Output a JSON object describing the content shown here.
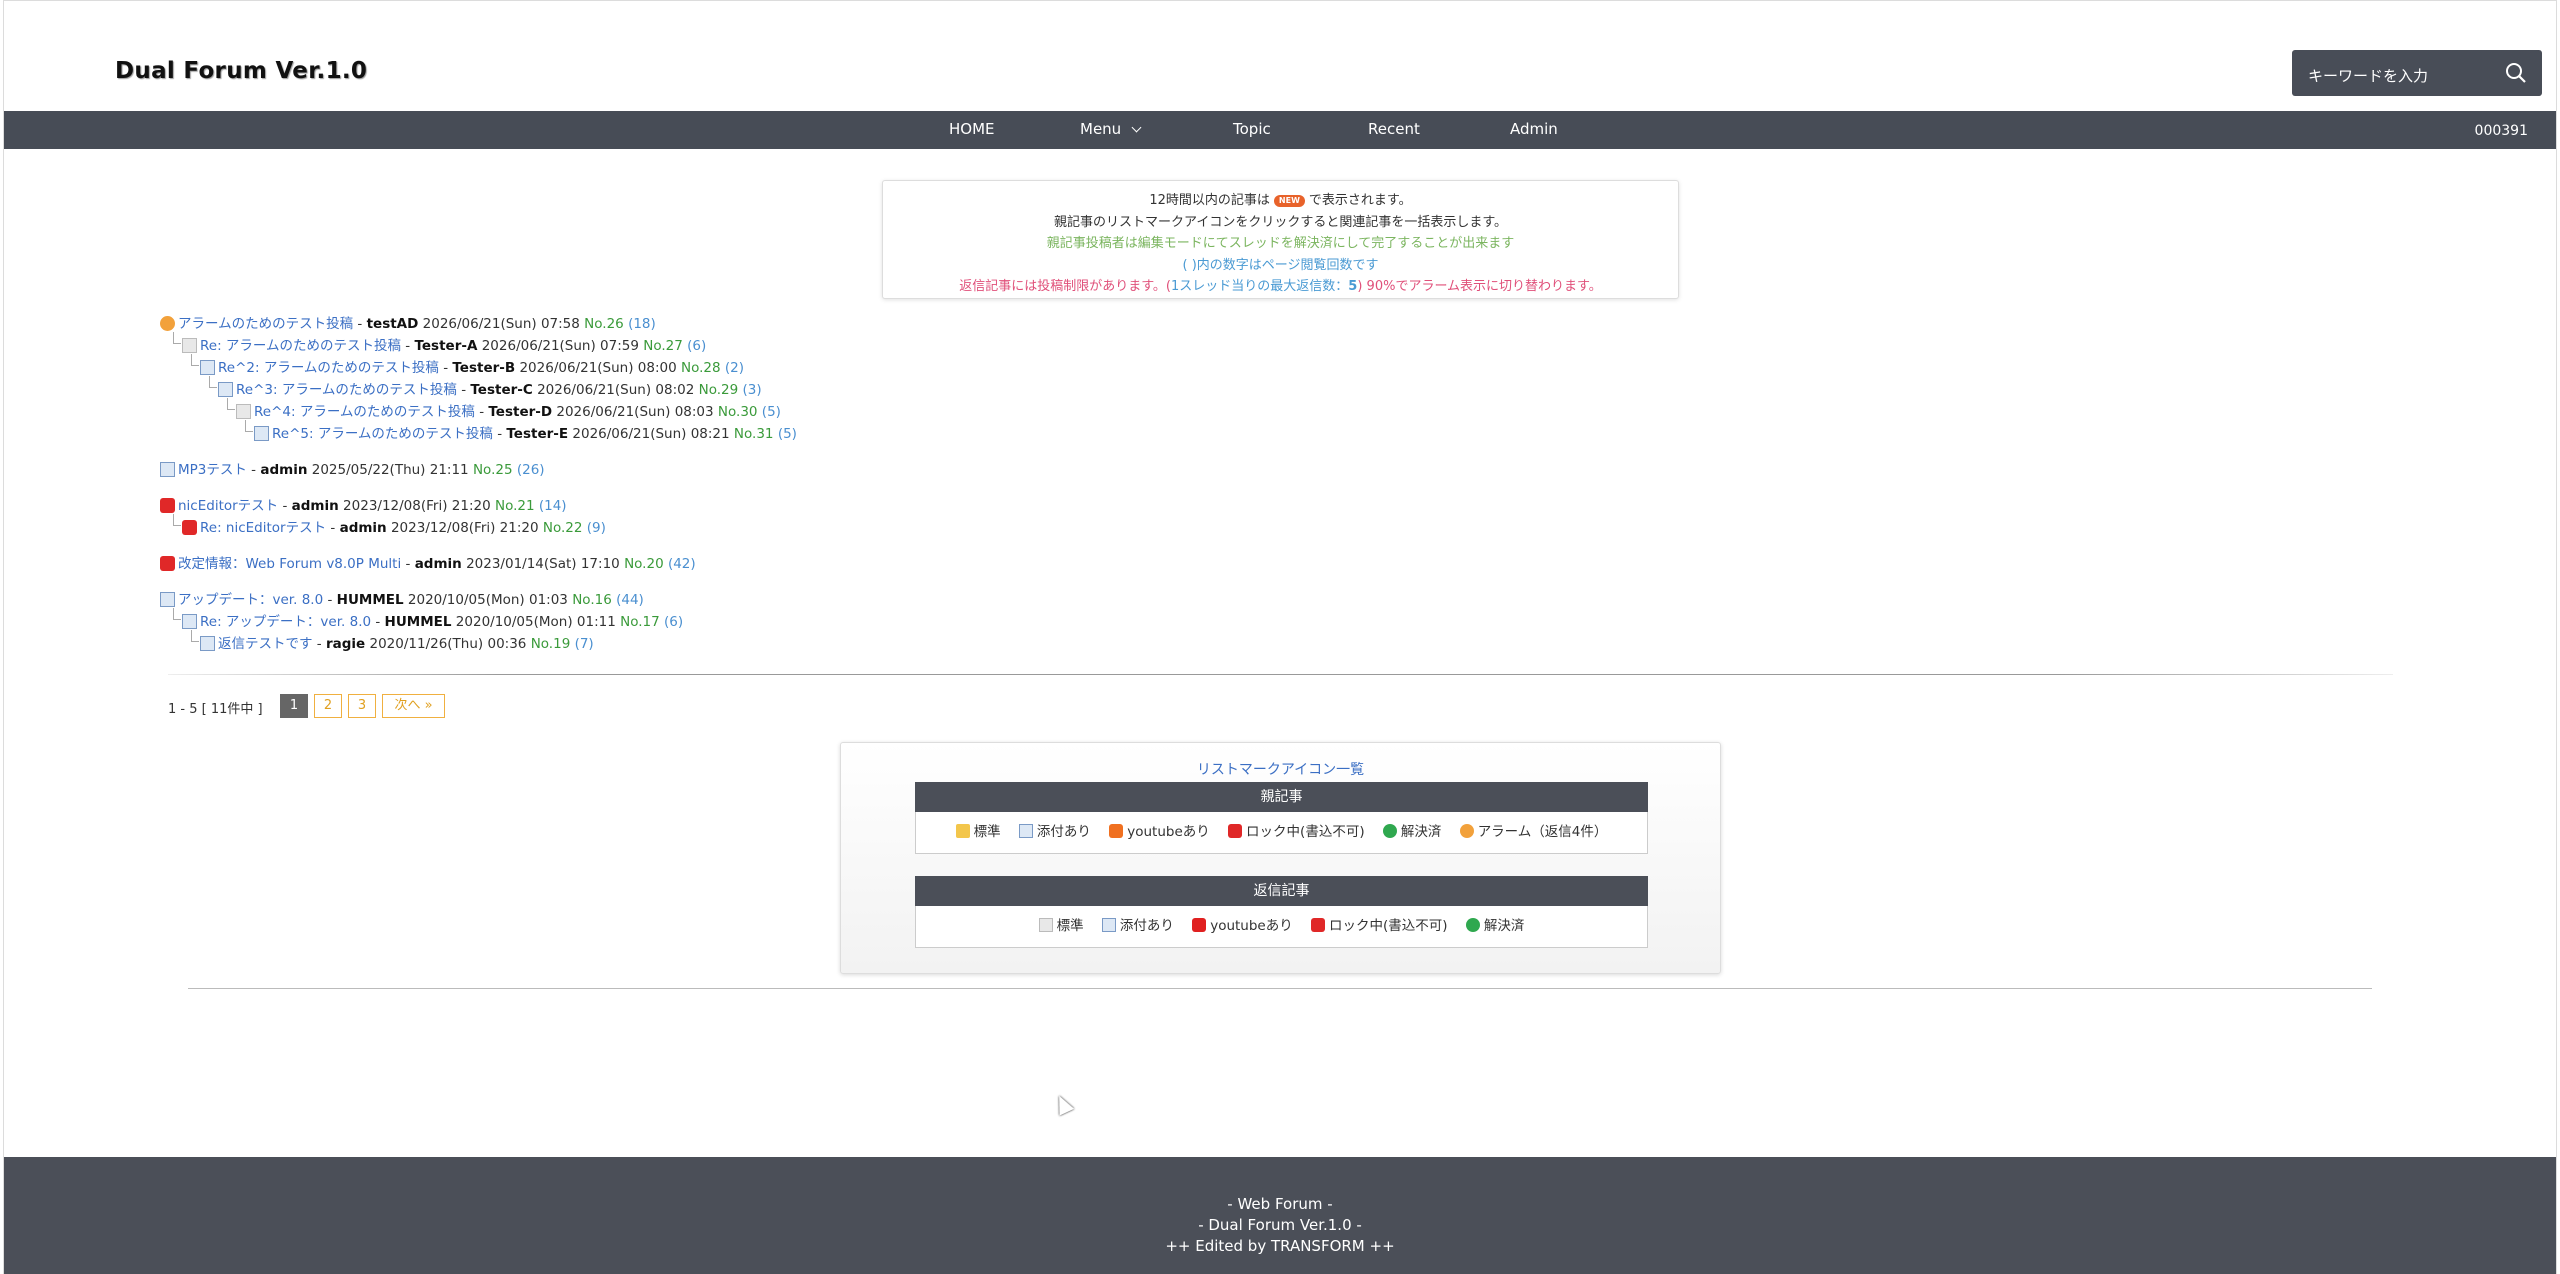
{
  "header": {
    "site_title": "Dual Forum Ver.1.0",
    "search_placeholder": "キーワードを入力"
  },
  "nav": {
    "items": [
      "HOME",
      "Menu",
      "Topic",
      "Recent",
      "Admin"
    ],
    "counter": "000391"
  },
  "info": {
    "line1_pre": "12時間以内の記事は",
    "new_badge": "NEW",
    "line1_post": "で表示されます。",
    "line2": "親記事のリストマークアイコンをクリックすると関連記事を一括表示します。",
    "line3": "親記事投稿者は編集モードにてスレッドを解決済にして完了することが出来ます",
    "line4": "( )内の数字はページ閲覧回数です",
    "line5_pre": "返信記事には投稿制限があります。(",
    "line5_mid": "1スレッド当りの最大返信数：",
    "line5_num": "5",
    "line5_post": ") 90%でアラーム表示に切り替わります。"
  },
  "threads": [
    {
      "icon": "alarm-icon",
      "title": "アラームのためのテスト投稿",
      "author": "testAD",
      "date": "2026/06/21(Sun) 07:58",
      "no": "No.26",
      "count": "(18)"
    },
    {
      "icon": "document-icon",
      "title": "Re: アラームのためのテスト投稿",
      "author": "Tester-A",
      "date": "2026/06/21(Sun) 07:59",
      "no": "No.27",
      "count": "(6)"
    },
    {
      "icon": "attachment-icon",
      "title": "Re^2: アラームのためのテスト投稿",
      "author": "Tester-B",
      "date": "2026/06/21(Sun) 08:00",
      "no": "No.28",
      "count": "(2)"
    },
    {
      "icon": "attachment-icon",
      "title": "Re^3: アラームのためのテスト投稿",
      "author": "Tester-C",
      "date": "2026/06/21(Sun) 08:02",
      "no": "No.29",
      "count": "(3)"
    },
    {
      "icon": "document-icon",
      "title": "Re^4: アラームのためのテスト投稿",
      "author": "Tester-D",
      "date": "2026/06/21(Sun) 08:03",
      "no": "No.30",
      "count": "(5)"
    },
    {
      "icon": "attachment-icon",
      "title": "Re^5: アラームのためのテスト投稿",
      "author": "Tester-E",
      "date": "2026/06/21(Sun) 08:21",
      "no": "No.31",
      "count": "(5)"
    },
    {
      "icon": "attachment-icon",
      "title": "MP3テスト",
      "author": "admin",
      "date": "2025/05/22(Thu) 21:11",
      "no": "No.25",
      "count": "(26)"
    },
    {
      "icon": "lock-icon",
      "title": "nicEditorテスト",
      "author": "admin",
      "date": "2023/12/08(Fri) 21:20",
      "no": "No.21",
      "count": "(14)"
    },
    {
      "icon": "lock-icon",
      "title": "Re: nicEditorテスト",
      "author": "admin",
      "date": "2023/12/08(Fri) 21:20",
      "no": "No.22",
      "count": "(9)"
    },
    {
      "icon": "lock-icon",
      "title": "改定情報：Web Forum v8.0P Multi",
      "author": "admin",
      "date": "2023/01/14(Sat) 17:10",
      "no": "No.20",
      "count": "(42)"
    },
    {
      "icon": "attachment-icon",
      "title": "アップデート：ver. 8.0",
      "author": "HUMMEL",
      "date": "2020/10/05(Mon) 01:03",
      "no": "No.16",
      "count": "(44)"
    },
    {
      "icon": "attachment-icon",
      "title": "Re: アップデート：ver. 8.0",
      "author": "HUMMEL",
      "date": "2020/10/05(Mon) 01:11",
      "no": "No.17",
      "count": "(6)"
    },
    {
      "icon": "attachment-icon",
      "title": "返信テストです",
      "author": "ragie",
      "date": "2020/11/26(Thu) 00:36",
      "no": "No.19",
      "count": "(7)"
    }
  ],
  "pager": {
    "label": "1 - 5 [ 11件中 ]",
    "pages": [
      "1",
      "2",
      "3"
    ],
    "next": "次へ »"
  },
  "legend": {
    "title": "リストマークアイコン一覧",
    "parent_head": "親記事",
    "parent_items": [
      "標準",
      "添付あり",
      "youtubeあり",
      "ロック中(書込不可)",
      "解決済",
      "アラーム（返信4件）"
    ],
    "reply_head": "返信記事",
    "reply_items": [
      "標準",
      "添付あり",
      "youtubeあり",
      "ロック中(書込不可)",
      "解決済"
    ]
  },
  "footer": {
    "line1": "- Web Forum -",
    "line2": "- Dual Forum Ver.1.0 -",
    "line3": "++ Edited by TRANSFORM ++"
  }
}
